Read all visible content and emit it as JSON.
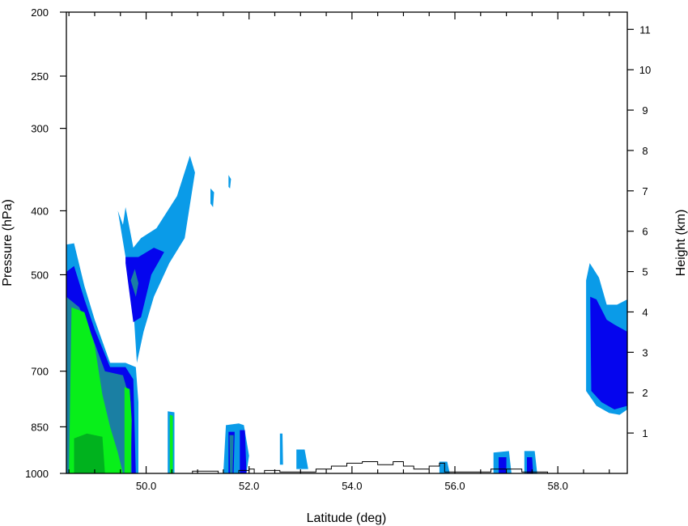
{
  "chart_data": {
    "type": "contour",
    "xlabel": "Latitude (deg)",
    "ylabel_left": "Pressure (hPa)",
    "ylabel_right": "Height (km)",
    "xlim": [
      48.45,
      59.35
    ],
    "x_ticks": [
      50.0,
      52.0,
      54.0,
      56.0,
      58.0
    ],
    "x_tick_labels": [
      "50.0",
      "52.0",
      "54.0",
      "56.0",
      "58.0"
    ],
    "pressure_scale": "log",
    "ylim_pressure": [
      1000,
      200
    ],
    "pressure_ticks": [
      200,
      250,
      300,
      400,
      500,
      700,
      850,
      1000
    ],
    "pressure_tick_labels": [
      "200",
      "250",
      "300",
      "400",
      "500",
      "700",
      "850",
      "1000"
    ],
    "height_ticks": [
      1,
      2,
      3,
      4,
      5,
      6,
      7,
      8,
      9,
      10,
      11
    ],
    "height_tick_labels": [
      "1",
      "2",
      "3",
      "4",
      "5",
      "6",
      "7",
      "8",
      "9",
      "10",
      "11"
    ],
    "grid": false,
    "contour_level_colors": [
      "#0a9be8",
      "#0505ee",
      "#1a7fa3",
      "#08ef1a",
      "#00b21e"
    ],
    "contour_regions": [
      {
        "level": 1,
        "name": "left-main",
        "points": [
          [
            48.45,
            450
          ],
          [
            48.6,
            448
          ],
          [
            48.8,
            520
          ],
          [
            49.0,
            585
          ],
          [
            49.3,
            680
          ],
          [
            49.6,
            680
          ],
          [
            49.8,
            690
          ],
          [
            49.85,
            780
          ],
          [
            49.85,
            1000
          ],
          [
            48.45,
            1000
          ]
        ]
      },
      {
        "level": 2,
        "name": "left-main",
        "points": [
          [
            48.45,
            495
          ],
          [
            48.6,
            485
          ],
          [
            48.8,
            545
          ],
          [
            49.0,
            605
          ],
          [
            49.3,
            690
          ],
          [
            49.6,
            690
          ],
          [
            49.75,
            720
          ],
          [
            49.8,
            1000
          ],
          [
            48.45,
            1000
          ]
        ]
      },
      {
        "level": 3,
        "name": "left-main",
        "points": [
          [
            48.45,
            540
          ],
          [
            48.7,
            560
          ],
          [
            48.95,
            620
          ],
          [
            49.2,
            700
          ],
          [
            49.55,
            710
          ],
          [
            49.7,
            780
          ],
          [
            49.72,
            1000
          ],
          [
            48.45,
            1000
          ]
        ]
      },
      {
        "level": 4,
        "name": "left-main",
        "points": [
          [
            48.55,
            560
          ],
          [
            48.8,
            570
          ],
          [
            49.0,
            640
          ],
          [
            49.15,
            760
          ],
          [
            49.3,
            850
          ],
          [
            49.45,
            930
          ],
          [
            49.55,
            1000
          ],
          [
            48.5,
            1000
          ]
        ]
      },
      {
        "level": 5,
        "name": "left-core",
        "points": [
          [
            48.6,
            885
          ],
          [
            48.85,
            870
          ],
          [
            49.15,
            880
          ],
          [
            49.2,
            1000
          ],
          [
            48.6,
            1000
          ]
        ]
      },
      {
        "level": 4,
        "name": "left-strip",
        "points": [
          [
            49.58,
            740
          ],
          [
            49.68,
            745
          ],
          [
            49.72,
            830
          ],
          [
            49.7,
            1000
          ],
          [
            49.58,
            1000
          ]
        ]
      },
      {
        "level": 1,
        "name": "upper-plume",
        "points": [
          [
            49.45,
            400
          ],
          [
            49.6,
            470
          ],
          [
            49.75,
            560
          ],
          [
            49.82,
            680
          ],
          [
            49.95,
            610
          ],
          [
            50.15,
            540
          ],
          [
            50.45,
            480
          ],
          [
            50.75,
            440
          ],
          [
            50.95,
            350
          ],
          [
            50.85,
            330
          ],
          [
            50.6,
            380
          ],
          [
            50.2,
            425
          ],
          [
            49.9,
            440
          ],
          [
            49.75,
            455
          ],
          [
            49.6,
            395
          ],
          [
            49.55,
            420
          ]
        ]
      },
      {
        "level": 2,
        "name": "upper-plume",
        "points": [
          [
            49.6,
            480
          ],
          [
            49.75,
            590
          ],
          [
            49.9,
            580
          ],
          [
            50.1,
            500
          ],
          [
            50.35,
            462
          ],
          [
            50.15,
            455
          ],
          [
            49.85,
            470
          ],
          [
            49.6,
            470
          ]
        ]
      },
      {
        "level": 3,
        "name": "upper-plume",
        "points": [
          [
            49.7,
            510
          ],
          [
            49.8,
            540
          ],
          [
            49.85,
            515
          ],
          [
            49.78,
            490
          ]
        ]
      },
      {
        "level": 1,
        "name": "cell-51.2",
        "points": [
          [
            51.25,
            370
          ],
          [
            51.32,
            375
          ],
          [
            51.3,
            395
          ],
          [
            51.25,
            390
          ]
        ]
      },
      {
        "level": 1,
        "name": "cell-51.6",
        "points": [
          [
            51.6,
            353
          ],
          [
            51.65,
            358
          ],
          [
            51.63,
            370
          ],
          [
            51.6,
            368
          ]
        ]
      },
      {
        "level": 1,
        "name": "cell-50.5",
        "points": [
          [
            50.42,
            805
          ],
          [
            50.55,
            808
          ],
          [
            50.55,
            1000
          ],
          [
            50.42,
            1000
          ]
        ]
      },
      {
        "level": 4,
        "name": "cell-50.5",
        "points": [
          [
            50.46,
            815
          ],
          [
            50.52,
            818
          ],
          [
            50.52,
            1000
          ],
          [
            50.46,
            1000
          ]
        ]
      },
      {
        "level": 1,
        "name": "cell-51.6",
        "points": [
          [
            51.55,
            845
          ],
          [
            51.8,
            840
          ],
          [
            51.9,
            845
          ],
          [
            52.0,
            940
          ],
          [
            51.95,
            1000
          ],
          [
            51.5,
            1000
          ]
        ]
      },
      {
        "level": 2,
        "name": "cell-51.6",
        "points": [
          [
            51.6,
            865
          ],
          [
            51.72,
            865
          ],
          [
            51.7,
            1000
          ],
          [
            51.6,
            1000
          ]
        ]
      },
      {
        "level": 3,
        "name": "cell-51.6",
        "points": [
          [
            51.62,
            875
          ],
          [
            51.7,
            875
          ],
          [
            51.68,
            1000
          ],
          [
            51.63,
            1000
          ]
        ]
      },
      {
        "level": 2,
        "name": "cell-51.9",
        "points": [
          [
            51.82,
            860
          ],
          [
            51.92,
            860
          ],
          [
            51.95,
            1000
          ],
          [
            51.82,
            1000
          ]
        ]
      },
      {
        "level": 1,
        "name": "cell-52.6",
        "points": [
          [
            52.6,
            870
          ],
          [
            52.65,
            870
          ],
          [
            52.66,
            970
          ],
          [
            52.6,
            970
          ]
        ]
      },
      {
        "level": 1,
        "name": "cell-53.0",
        "points": [
          [
            52.92,
            920
          ],
          [
            53.08,
            920
          ],
          [
            53.15,
            985
          ],
          [
            52.92,
            985
          ]
        ]
      },
      {
        "level": 1,
        "name": "cell-55.8",
        "points": [
          [
            55.7,
            960
          ],
          [
            55.85,
            960
          ],
          [
            55.9,
            1000
          ],
          [
            55.7,
            1000
          ]
        ]
      },
      {
        "level": 1,
        "name": "cell-57.0",
        "points": [
          [
            56.75,
            930
          ],
          [
            57.05,
            925
          ],
          [
            57.1,
            1000
          ],
          [
            56.75,
            1000
          ]
        ]
      },
      {
        "level": 2,
        "name": "cell-57.0",
        "points": [
          [
            56.85,
            945
          ],
          [
            57.0,
            945
          ],
          [
            57.0,
            1000
          ],
          [
            56.85,
            1000
          ]
        ]
      },
      {
        "level": 1,
        "name": "cell-57.4",
        "points": [
          [
            57.35,
            925
          ],
          [
            57.55,
            925
          ],
          [
            57.6,
            1000
          ],
          [
            57.35,
            1000
          ]
        ]
      },
      {
        "level": 2,
        "name": "cell-57.4",
        "points": [
          [
            57.4,
            945
          ],
          [
            57.5,
            945
          ],
          [
            57.52,
            1000
          ],
          [
            57.4,
            1000
          ]
        ]
      },
      {
        "level": 1,
        "name": "right-region",
        "points": [
          [
            59.35,
            545
          ],
          [
            59.15,
            555
          ],
          [
            58.95,
            555
          ],
          [
            58.8,
            505
          ],
          [
            58.62,
            480
          ],
          [
            58.55,
            510
          ],
          [
            58.55,
            750
          ],
          [
            58.75,
            790
          ],
          [
            59.0,
            810
          ],
          [
            59.2,
            815
          ],
          [
            59.35,
            800
          ]
        ]
      },
      {
        "level": 2,
        "name": "right-region",
        "points": [
          [
            59.35,
            610
          ],
          [
            59.1,
            595
          ],
          [
            58.95,
            585
          ],
          [
            58.75,
            545
          ],
          [
            58.63,
            540
          ],
          [
            58.65,
            750
          ],
          [
            58.85,
            780
          ],
          [
            59.1,
            800
          ],
          [
            59.35,
            790
          ]
        ]
      }
    ],
    "terrain_profile": [
      [
        49.9,
        1000
      ],
      [
        50.9,
        1000
      ],
      [
        50.9,
        992
      ],
      [
        51.4,
        992
      ],
      [
        51.4,
        1000
      ],
      [
        51.8,
        1000
      ],
      [
        51.8,
        990
      ],
      [
        52.0,
        990
      ],
      [
        52.0,
        985
      ],
      [
        52.1,
        985
      ],
      [
        52.1,
        1000
      ],
      [
        52.3,
        1000
      ],
      [
        52.3,
        990
      ],
      [
        52.6,
        990
      ],
      [
        52.6,
        995
      ],
      [
        53.3,
        995
      ],
      [
        53.3,
        985
      ],
      [
        53.6,
        985
      ],
      [
        53.6,
        975
      ],
      [
        53.9,
        975
      ],
      [
        53.9,
        965
      ],
      [
        54.2,
        965
      ],
      [
        54.2,
        960
      ],
      [
        54.5,
        960
      ],
      [
        54.5,
        970
      ],
      [
        54.8,
        970
      ],
      [
        54.8,
        960
      ],
      [
        55.0,
        960
      ],
      [
        55.0,
        975
      ],
      [
        55.2,
        975
      ],
      [
        55.2,
        985
      ],
      [
        55.5,
        985
      ],
      [
        55.5,
        975
      ],
      [
        55.7,
        975
      ],
      [
        55.7,
        965
      ],
      [
        55.8,
        965
      ],
      [
        55.8,
        995
      ],
      [
        56.7,
        995
      ],
      [
        56.7,
        985
      ],
      [
        57.3,
        985
      ],
      [
        57.3,
        995
      ],
      [
        57.8,
        995
      ],
      [
        57.8,
        1000
      ],
      [
        57.85,
        1000
      ]
    ]
  }
}
